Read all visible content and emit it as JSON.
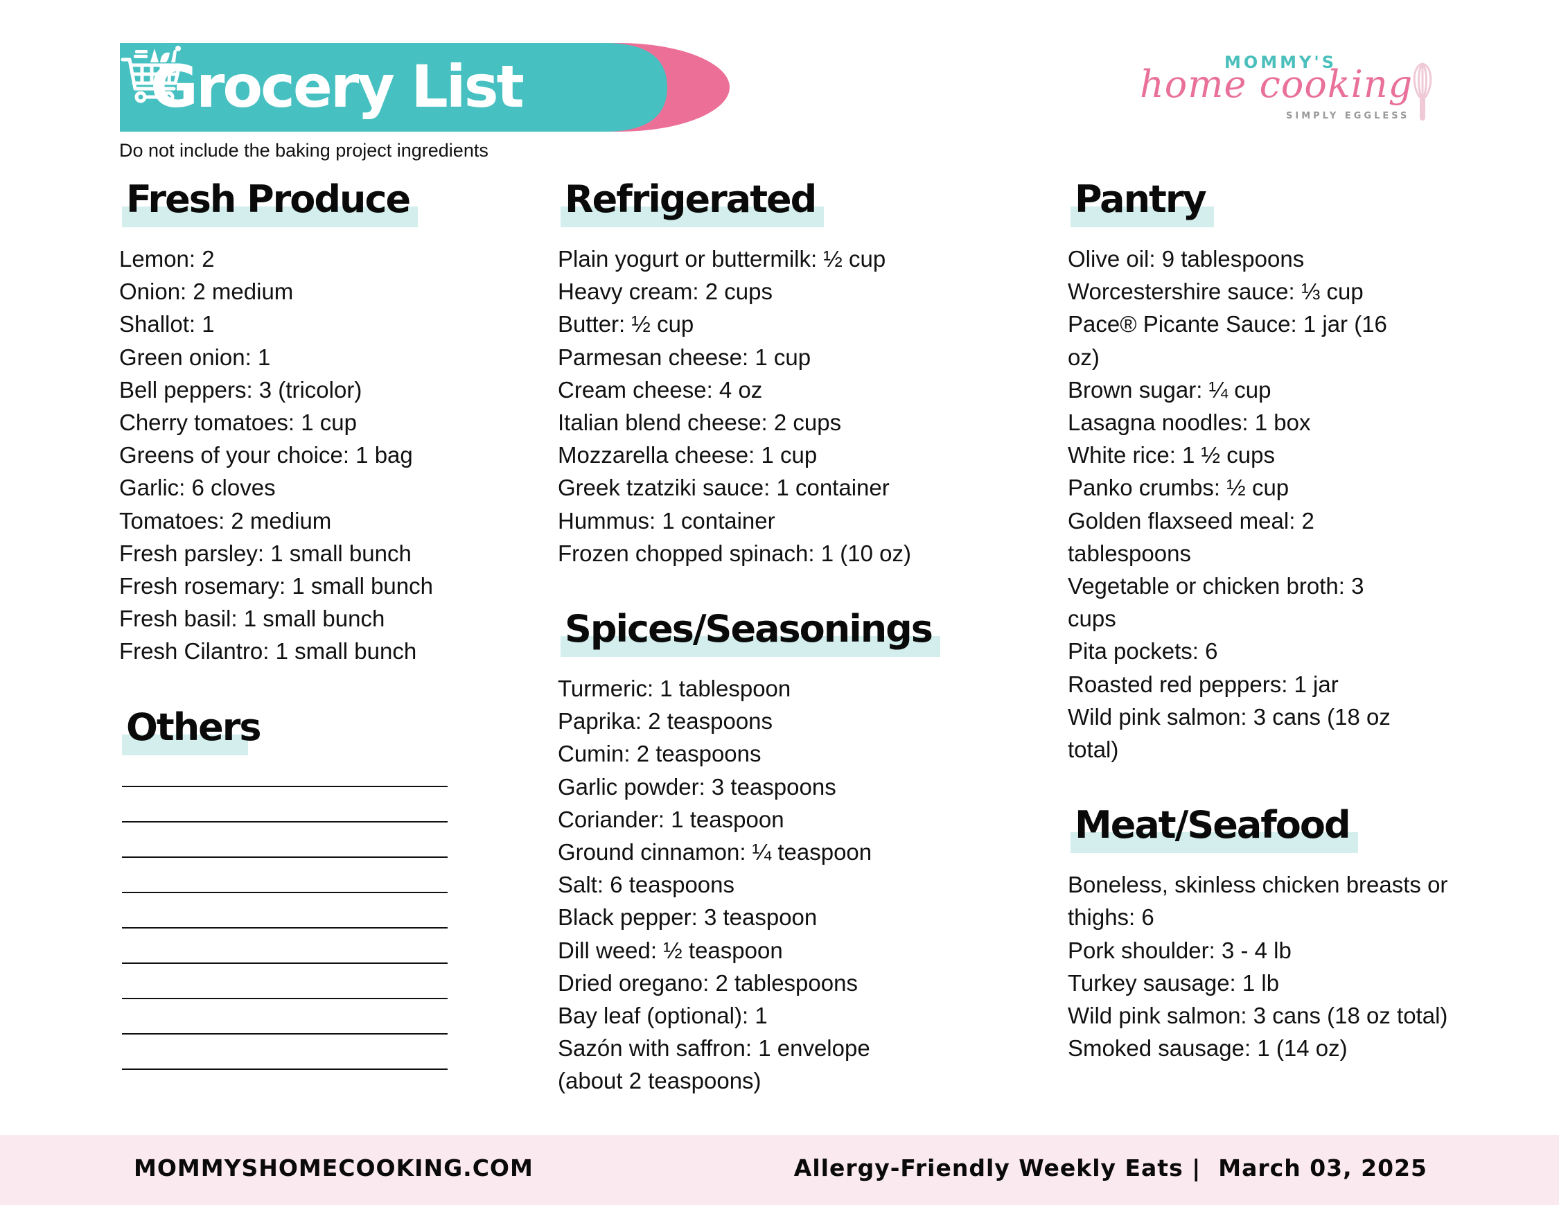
{
  "header": {
    "title": "Grocery List",
    "title_icon": "shopping-cart-icon",
    "subtitle": "Do not include the baking project ingredients",
    "colors": {
      "teal": "#47c0c1",
      "pink": "#ec6f97",
      "highlight": "#d3eeec",
      "footer_bg": "#fbe9f0"
    }
  },
  "logo": {
    "top": "MOMMY'S",
    "script": "home cooking",
    "tagline": "SIMPLY EGGLESS",
    "icon": "whisk-icon"
  },
  "sections": {
    "fresh_produce": {
      "title": "Fresh Produce",
      "items": [
        "Lemon: 2",
        "Onion: 2 medium",
        "Shallot: 1",
        "Green onion: 1",
        "Bell peppers: 3 (tricolor)",
        "Cherry tomatoes: 1 cup",
        "Greens of your choice: 1 bag",
        "Garlic: 6 cloves",
        "Tomatoes: 2 medium",
        "Fresh parsley: 1 small bunch",
        "Fresh rosemary: 1 small bunch",
        "Fresh basil: 1 small bunch",
        "Fresh Cilantro: 1 small bunch"
      ]
    },
    "others": {
      "title": "Others",
      "blank_lines": 9
    },
    "refrigerated": {
      "title": "Refrigerated",
      "items": [
        "Plain yogurt or buttermilk: ½ cup",
        "Heavy cream: 2 cups",
        "Butter: ½ cup",
        "Parmesan cheese: 1 cup",
        "Cream cheese: 4 oz",
        "Italian blend cheese: 2 cups",
        "Mozzarella cheese: 1 cup",
        "Greek tzatziki sauce: 1 container",
        "Hummus: 1 container",
        "Frozen chopped spinach: 1 (10 oz)"
      ]
    },
    "spices": {
      "title": "Spices/Seasonings",
      "items": [
        "Turmeric: 1 tablespoon",
        "Paprika: 2 teaspoons",
        "Cumin: 2 teaspoons",
        "Garlic powder: 3 teaspoons",
        "Coriander: 1 teaspoon",
        "Ground cinnamon: ¼ teaspoon",
        "Salt: 6 teaspoons",
        "Black pepper: 3 teaspoon",
        "Dill weed: ½ teaspoon",
        "Dried oregano: 2 tablespoons",
        "Bay leaf (optional): 1",
        "Sazón with saffron: 1 envelope",
        "(about 2 teaspoons)"
      ]
    },
    "pantry": {
      "title": "Pantry",
      "items": [
        "Olive oil: 9 tablespoons",
        "Worcestershire sauce: ⅓ cup",
        "Pace® Picante Sauce: 1 jar (16",
        "oz)",
        "Brown sugar: ¼ cup",
        "Lasagna noodles: 1 box",
        "White rice: 1 ½ cups",
        "Panko crumbs: ½ cup",
        "Golden flaxseed meal: 2",
        "tablespoons",
        "Vegetable or chicken broth: 3",
        "cups",
        "Pita pockets: 6",
        "Roasted red peppers: 1 jar",
        "Wild pink salmon: 3 cans (18 oz",
        "total)"
      ]
    },
    "meat_seafood": {
      "title": "Meat/Seafood",
      "items": [
        "Boneless, skinless chicken breasts or",
        "thighs: 6",
        "Pork shoulder: 3 - 4 lb",
        "Turkey sausage: 1 lb",
        "Wild pink salmon: 3 cans (18 oz total)",
        "Smoked sausage: 1 (14 oz)"
      ]
    }
  },
  "footer": {
    "website": "MOMMYSHOMECOOKING.COM",
    "series": "Allergy-Friendly Weekly Eats",
    "separator": "|",
    "date": "March 03, 2025"
  }
}
